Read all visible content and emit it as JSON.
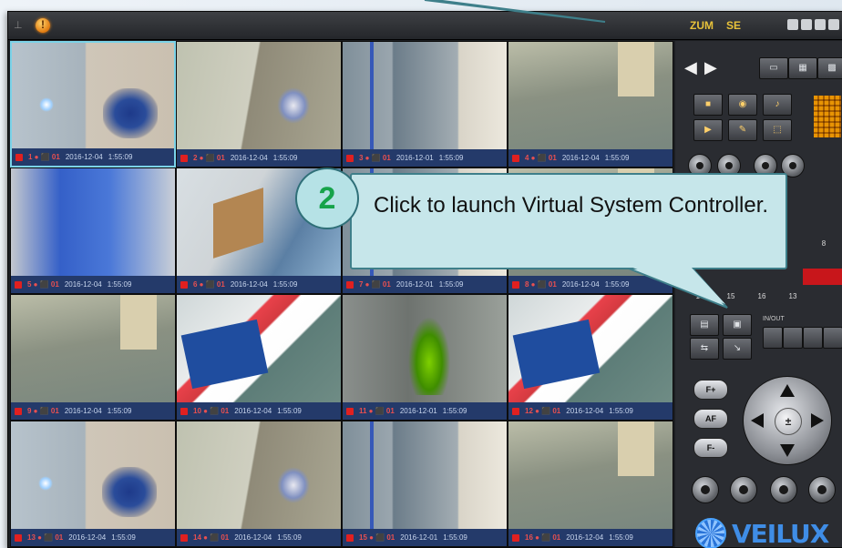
{
  "app": {
    "mode_labels": [
      "ZUM",
      "SE"
    ]
  },
  "cameras": [
    {
      "scene": "scene-lobby",
      "selected": true,
      "caption": [
        "1 ● ⬛ 01",
        "2016-12-04",
        "1:55:09"
      ]
    },
    {
      "scene": "scene-room",
      "selected": false,
      "caption": [
        "2 ● ⬛ 01",
        "2016-12-04",
        "1:55:09"
      ]
    },
    {
      "scene": "scene-glass",
      "selected": false,
      "caption": [
        "3 ● ⬛ 01",
        "2016-12-01",
        "1:55:09"
      ]
    },
    {
      "scene": "scene-floor",
      "selected": false,
      "caption": [
        "4 ● ⬛ 01",
        "2016-12-04",
        "1:55:09"
      ]
    },
    {
      "scene": "scene-blue",
      "selected": false,
      "caption": [
        "5 ● ⬛ 01",
        "2016-12-04",
        "1:55:09"
      ]
    },
    {
      "scene": "scene-chair",
      "selected": false,
      "caption": [
        "6 ● ⬛ 01",
        "2016-12-04",
        "1:55:09"
      ]
    },
    {
      "scene": "scene-glass",
      "selected": false,
      "caption": [
        "7 ● ⬛ 01",
        "2016-12-01",
        "1:55:09"
      ]
    },
    {
      "scene": "scene-floor",
      "selected": false,
      "caption": [
        "8 ● ⬛ 01",
        "2016-12-04",
        "1:55:09"
      ]
    },
    {
      "scene": "scene-floor",
      "selected": false,
      "caption": [
        "9 ● ⬛ 01",
        "2016-12-04",
        "1:55:09"
      ]
    },
    {
      "scene": "scene-poster",
      "selected": false,
      "caption": [
        "10 ● ⬛ 01",
        "2016-12-04",
        "1:55:09"
      ]
    },
    {
      "scene": "scene-plant",
      "selected": false,
      "caption": [
        "11 ● ⬛ 01",
        "2016-12-01",
        "1:55:09"
      ]
    },
    {
      "scene": "scene-poster",
      "selected": false,
      "caption": [
        "12 ● ⬛ 01",
        "2016-12-04",
        "1:55:09"
      ]
    },
    {
      "scene": "scene-lobby",
      "selected": false,
      "caption": [
        "13 ● ⬛ 01",
        "2016-12-04",
        "1:55:09"
      ]
    },
    {
      "scene": "scene-room",
      "selected": false,
      "caption": [
        "14 ● ⬛ 01",
        "2016-12-04",
        "1:55:09"
      ]
    },
    {
      "scene": "scene-glass",
      "selected": false,
      "caption": [
        "15 ● ⬛ 01",
        "2016-12-01",
        "1:55:09"
      ]
    },
    {
      "scene": "scene-floor",
      "selected": false,
      "caption": [
        "16 ● ⬛ 01",
        "2016-12-04",
        "1:55:09"
      ]
    }
  ],
  "panel": {
    "numbers_row1": [
      "",
      "",
      "",
      "",
      "8"
    ],
    "numbers_row2": [
      "14",
      "15",
      "16",
      "13"
    ],
    "ptz_label": "IN/OUT",
    "side_buttons": [
      "F+",
      "AF",
      "F-"
    ],
    "brand": "VEILUX"
  },
  "callout": {
    "step": "2",
    "text": "Click to launch Virtual System Controller."
  },
  "colors": {
    "accent": "#c6e6ea",
    "step_number": "#16a34a",
    "brand": "#3f8de6",
    "caption_bar": "#243a6a"
  }
}
